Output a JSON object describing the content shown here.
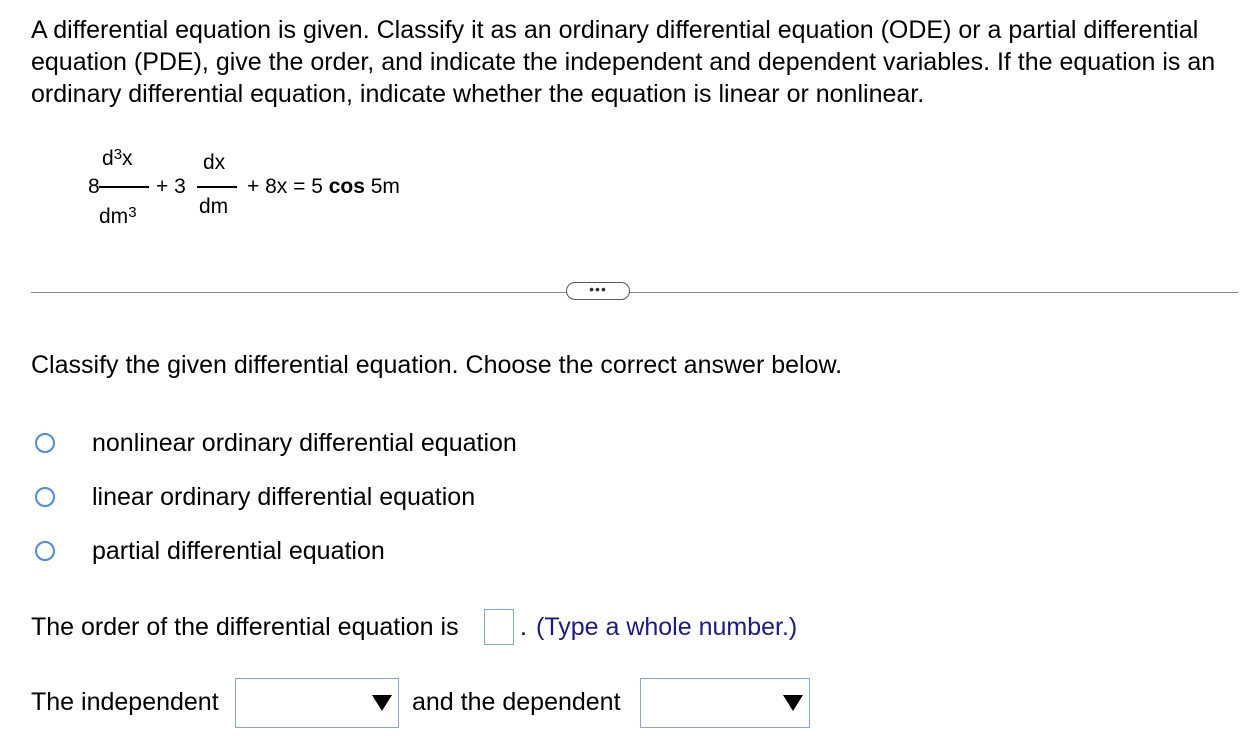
{
  "problem_text": "A differential equation is given. Classify it as an ordinary differential equation (ODE) or a partial differential equation (PDE), give the order, and indicate the independent and dependent variables. If the equation is an ordinary differential equation, indicate whether the equation is linear or nonlinear.",
  "equation": {
    "coef1": "8",
    "num1": "d",
    "num1_exp": "3",
    "num1_var": "x",
    "den1": "dm",
    "den1_exp": "3",
    "plus1": "+ 3",
    "num2": "dx",
    "den2": "dm",
    "rest_a": "+ 8x = 5 ",
    "rest_cos": "cos",
    "rest_b": " 5m"
  },
  "more_label": "•••",
  "instruction": "Classify the given differential equation. Choose the correct answer below.",
  "options": [
    "nonlinear ordinary differential equation",
    "linear ordinary differential equation",
    "partial differential equation"
  ],
  "order_prompt": "The order of the differential equation is",
  "order_value": "",
  "order_period": ".",
  "order_hint": "(Type a whole number.)",
  "independent_label": "The independent",
  "dependent_label": "and the dependent",
  "independent_value": "",
  "dependent_value": "",
  "colors": {
    "radio_border": "#4a8be8",
    "input_border": "#7fa7e8",
    "hint_text": "#1a1a8c"
  }
}
